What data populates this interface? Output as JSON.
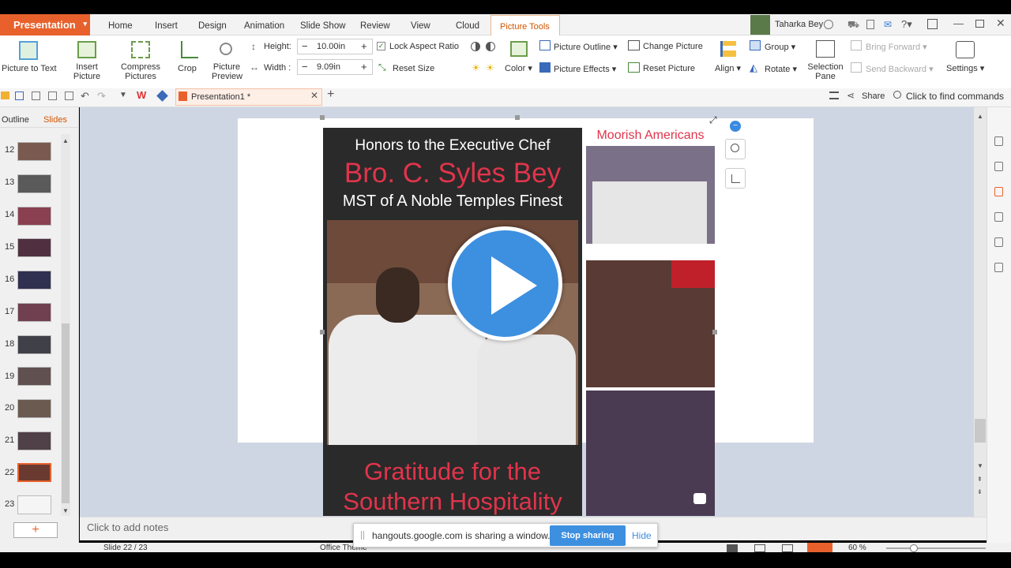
{
  "app": {
    "name": "Presentation"
  },
  "tabs": [
    "Home",
    "Insert",
    "Design",
    "Animation",
    "Slide Show",
    "Review",
    "View",
    "Cloud"
  ],
  "context_tab": "Picture Tools",
  "user": {
    "name": "Taharka Bey"
  },
  "ribbon": {
    "picture_to_text": "Picture to Text",
    "insert_picture_1": "Insert",
    "insert_picture_2": "Picture",
    "compress_1": "Compress",
    "compress_2": "Pictures",
    "crop": "Crop",
    "preview_1": "Picture",
    "preview_2": "Preview",
    "height_label": "Height:",
    "height_value": "10.00in",
    "width_label": "Width :",
    "width_value": "9.09in",
    "lock_aspect": "Lock Aspect Ratio",
    "reset_size": "Reset Size",
    "color": "Color",
    "picture_outline": "Picture Outline",
    "picture_effects": "Picture Effects",
    "change_picture": "Change Picture",
    "reset_picture": "Reset Picture",
    "align": "Align",
    "group": "Group",
    "rotate": "Rotate",
    "selection_1": "Selection",
    "selection_2": "Pane",
    "bring_forward": "Bring Forward",
    "send_backward": "Send Backward",
    "settings": "Settings"
  },
  "doc_tab": "Presentation1 *",
  "share": "Share",
  "find_commands": "Click to find commands",
  "panel_tabs": {
    "outline": "Outline",
    "slides": "Slides"
  },
  "slides": [
    "12",
    "13",
    "14",
    "15",
    "16",
    "17",
    "18",
    "19",
    "20",
    "21",
    "22",
    "23"
  ],
  "active_slide": "22",
  "poster": {
    "line1": "Honors to the Executive Chef",
    "line2": "Bro. C. Syles Bey",
    "line3": "MST of A Noble Temples Finest",
    "bottom1": "Gratitude for the",
    "bottom2": "Southern Hospitality",
    "side_title": "Moorish Americans"
  },
  "notes_placeholder": "Click to add notes",
  "status": {
    "slide_of": "Slide 22 / 23",
    "theme": "Office Theme",
    "zoom": "60 %"
  },
  "share_banner": {
    "message": "hangouts.google.com is sharing a window.",
    "stop": "Stop sharing",
    "hide": "Hide"
  },
  "colors": {
    "accent": "#e8612c",
    "poster_red": "#e0344b",
    "play": "#3d8fe0"
  }
}
